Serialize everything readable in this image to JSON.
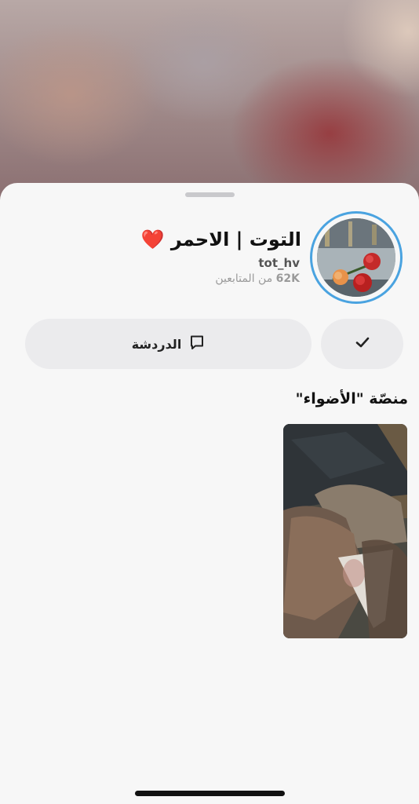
{
  "profile": {
    "display_name": "التوت | الاحمر ❤️",
    "username": "tot_hv",
    "followers_count": "62K",
    "followers_label": "من المتابعين"
  },
  "actions": {
    "chat_label": "الدردشة"
  },
  "spotlight": {
    "title": "منصّة \"الأضواء\""
  },
  "colors": {
    "story_ring": "#4aa3e0",
    "button_bg": "#ebebed",
    "sheet_bg": "#f7f7f7"
  },
  "icons": {
    "chat": "chat-bubble-icon",
    "check": "checkmark-icon"
  }
}
